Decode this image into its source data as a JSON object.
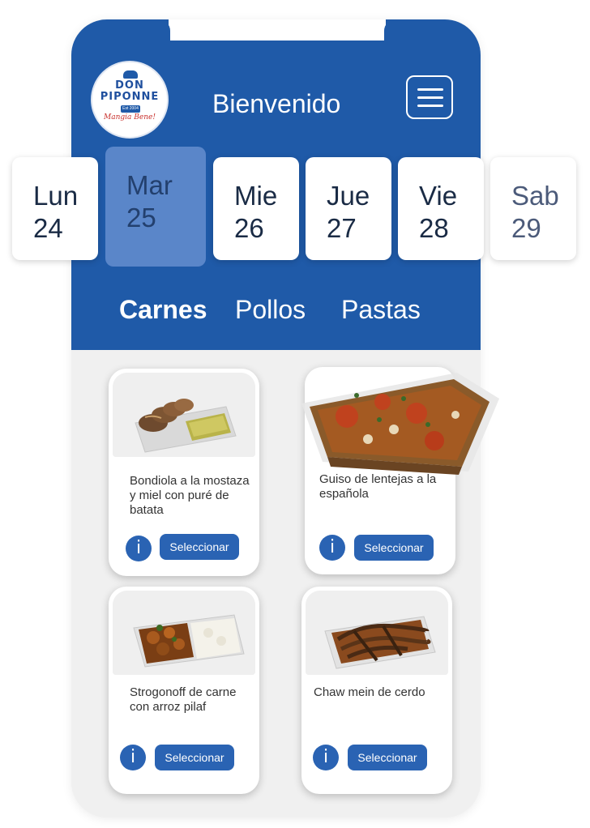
{
  "brand": {
    "name_line1": "DON",
    "name_line2": "PIPONNE",
    "established": "Est 2004",
    "tagline": "Mangia Bene!"
  },
  "header": {
    "greeting": "Bienvenido",
    "menu_icon": "hamburger-menu-icon"
  },
  "days": [
    {
      "name": "Lun",
      "date": "24"
    },
    {
      "name": "Mar",
      "date": "25"
    },
    {
      "name": "Mie",
      "date": "26"
    },
    {
      "name": "Jue",
      "date": "27"
    },
    {
      "name": "Vie",
      "date": "28"
    },
    {
      "name": "Sab",
      "date": "29"
    }
  ],
  "selected_day": "Mar 25",
  "categories": [
    "Carnes",
    "Pollos",
    "Pastas"
  ],
  "active_category": "Carnes",
  "meals": [
    {
      "name": "Bondiola a la mostaza y miel con puré de batata",
      "info_label": "i",
      "select_label": "Seleccionar"
    },
    {
      "name": "Guiso de lentejas a la española",
      "info_label": "i",
      "select_label": "Seleccionar"
    },
    {
      "name": "Strogonoff de carne con arroz pilaf",
      "info_label": "i",
      "select_label": "Seleccionar"
    },
    {
      "name": "Chaw mein de cerdo",
      "info_label": "i",
      "select_label": "Seleccionar"
    }
  ],
  "colors": {
    "primary": "#1f5aa8",
    "selected_day": "#5a86c9",
    "button": "#2a63b3",
    "background": "#f0f0f0"
  }
}
